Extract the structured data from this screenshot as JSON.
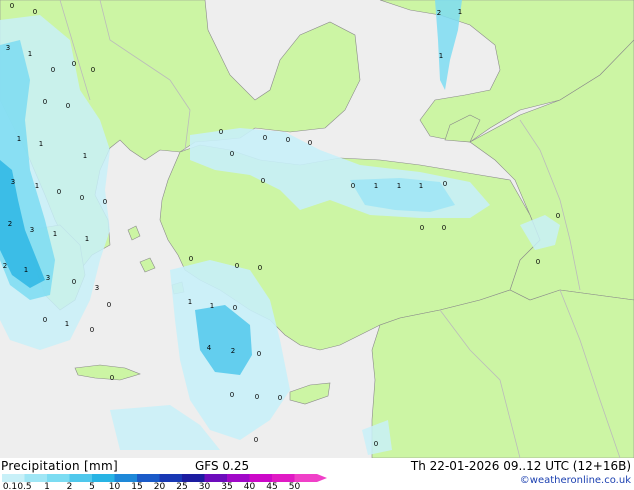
{
  "header": {
    "legend_title": "Precipitation [mm]",
    "model": "GFS 0.25",
    "valid_time": "Th 22-01-2026 09..12 UTC (12+16B)",
    "credit": "©weatheronline.co.uk"
  },
  "legend": {
    "ticks": [
      "0.1",
      "0.5",
      "1",
      "2",
      "5",
      "10",
      "15",
      "20",
      "25",
      "30",
      "35",
      "40",
      "45",
      "50"
    ],
    "colors": [
      "#c8f0f8",
      "#a0e6f5",
      "#7cdcf2",
      "#50c8ec",
      "#28b4e4",
      "#1e88d8",
      "#1a5ac8",
      "#1838b4",
      "#1c1ca0",
      "#6c0cbc",
      "#a008c8",
      "#cc08c8",
      "#e01ac4",
      "#f040c8"
    ]
  },
  "map": {
    "land_color": "#ccf5a4",
    "sea_color": "#eeeeee",
    "border_color": "#bbbbbb",
    "values": [
      "0",
      "2",
      "1",
      "3",
      "1",
      "0",
      "0",
      "0",
      "0",
      "1",
      "0",
      "0",
      "1",
      "1",
      "1",
      "3",
      "1",
      "0",
      "0",
      "2",
      "3",
      "1",
      "1",
      "0",
      "3",
      "2",
      "1",
      "0",
      "0",
      "3",
      "0",
      "1",
      "0",
      "0",
      "0",
      "0",
      "0",
      "0",
      "0",
      "0",
      "0",
      "1",
      "1",
      "1",
      "0",
      "0",
      "0",
      "0",
      "0",
      "0",
      "0",
      "1",
      "1",
      "0",
      "4",
      "2",
      "0",
      "0",
      "0",
      "0",
      "0",
      "0",
      "0"
    ]
  }
}
